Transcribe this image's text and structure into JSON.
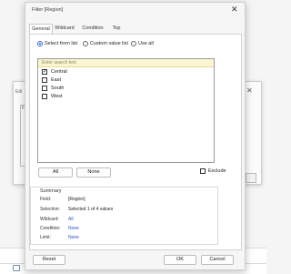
{
  "dialog": {
    "title": "Filter [Region]",
    "close_glyph": "✕",
    "tabs": [
      "General",
      "Wildcard",
      "Condition",
      "Top"
    ]
  },
  "selection_mode": {
    "options": [
      "Select from list",
      "Custom value list",
      "Use all"
    ],
    "selected": "Select from list"
  },
  "list": {
    "search_placeholder": "Enter search text",
    "items": [
      {
        "label": "Central",
        "checked": true
      },
      {
        "label": "East",
        "checked": false
      },
      {
        "label": "South",
        "checked": false
      },
      {
        "label": "West",
        "checked": false
      }
    ]
  },
  "buttons": {
    "all": "All",
    "none": "None",
    "exclude_label": "Exclude",
    "reset": "Reset",
    "ok": "OK",
    "cancel": "Cancel"
  },
  "summary": {
    "title": "Summary",
    "rows": [
      {
        "label": "Field:",
        "value": "[Region]",
        "link": false
      },
      {
        "label": "Selection:",
        "value": "Selected 1 of 4 values",
        "link": false
      },
      {
        "label": "Wildcard:",
        "value": "All",
        "link": true
      },
      {
        "label": "Condition:",
        "value": "None",
        "link": true
      },
      {
        "label": "Limit:",
        "value": "None",
        "link": true
      }
    ]
  },
  "background": {
    "dialog_title": "Edi",
    "inner_label": "Filt",
    "close_glyph": "✕"
  },
  "colors": {
    "accent": "#2566c9",
    "link": "#2a55c4",
    "search_bg": "#fbf6cf"
  }
}
